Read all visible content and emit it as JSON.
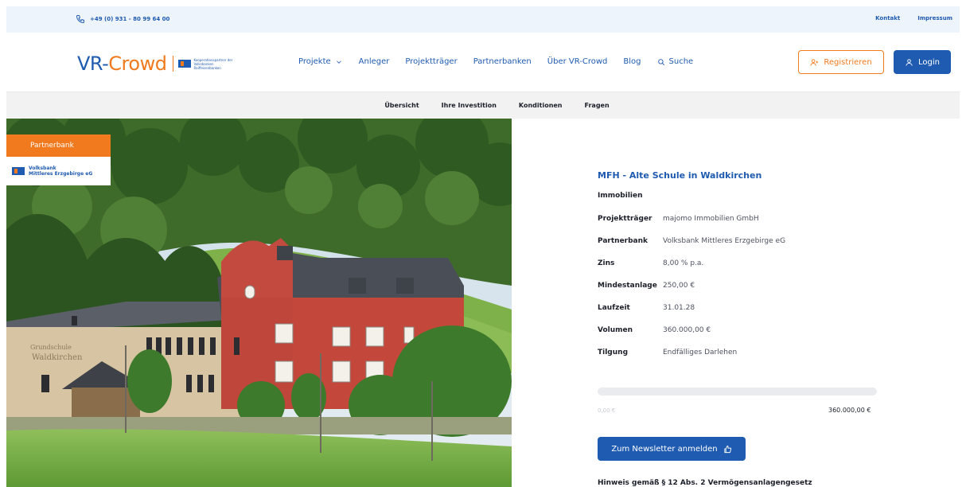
{
  "topbar": {
    "phone": "+49 (0) 931 - 80 99 64 00",
    "links": [
      "Kontakt",
      "Impressum"
    ]
  },
  "logo": {
    "part1": "VR-",
    "part2": "Crowd",
    "tagline_line1": "Kooperationspartner der",
    "tagline_line2": "Volksbanken",
    "tagline_line3": "Raiffeisenbanken"
  },
  "nav": {
    "projekte": "Projekte",
    "anleger": "Anleger",
    "projekttraeger": "Projektträger",
    "partnerbanken": "Partnerbanken",
    "ueber": "Über VR-Crowd",
    "blog": "Blog",
    "suche": "Suche"
  },
  "auth": {
    "register": "Registrieren",
    "login": "Login"
  },
  "subnav": [
    "Übersicht",
    "Ihre Investition",
    "Konditionen",
    "Fragen"
  ],
  "badge": {
    "label": "Partnerbank",
    "bank_line1": "Volksbank",
    "bank_line2": "Mittleres Erzgebirge eG"
  },
  "hero": {
    "sign_line1": "Grundschule",
    "sign_line2": "Waldkirchen"
  },
  "project": {
    "title": "MFH - Alte Schule in Waldkirchen",
    "category": "Immobilien",
    "rows": [
      {
        "k": "Projektträger",
        "v": "majomo Immobilien GmbH"
      },
      {
        "k": "Partnerbank",
        "v": "Volksbank Mittleres Erzgebirge eG"
      },
      {
        "k": "Zins",
        "v": "8,00 % p.a."
      },
      {
        "k": "Mindestanlage",
        "v": "250,00 €"
      },
      {
        "k": "Laufzeit",
        "v": "31.01.28"
      },
      {
        "k": "Volumen",
        "v": "360.000,00 €"
      },
      {
        "k": "Tilgung",
        "v": "Endfälliges Darlehen"
      }
    ],
    "progress_fraction": 0,
    "progress_min": "0,00 €",
    "progress_max": "360.000,00 €"
  },
  "newsletter": "Zum Newsletter anmelden",
  "hint": "Hinweis gemäß § 12 Abs. 2 Vermögensanlagengesetz",
  "colors": {
    "brand_blue": "#1f5bb0",
    "brand_orange": "#f07a1d"
  },
  "icons": [
    "phone-icon",
    "chevron-down-icon",
    "search-icon",
    "user-plus-icon",
    "user-icon",
    "thumb-icon"
  ]
}
